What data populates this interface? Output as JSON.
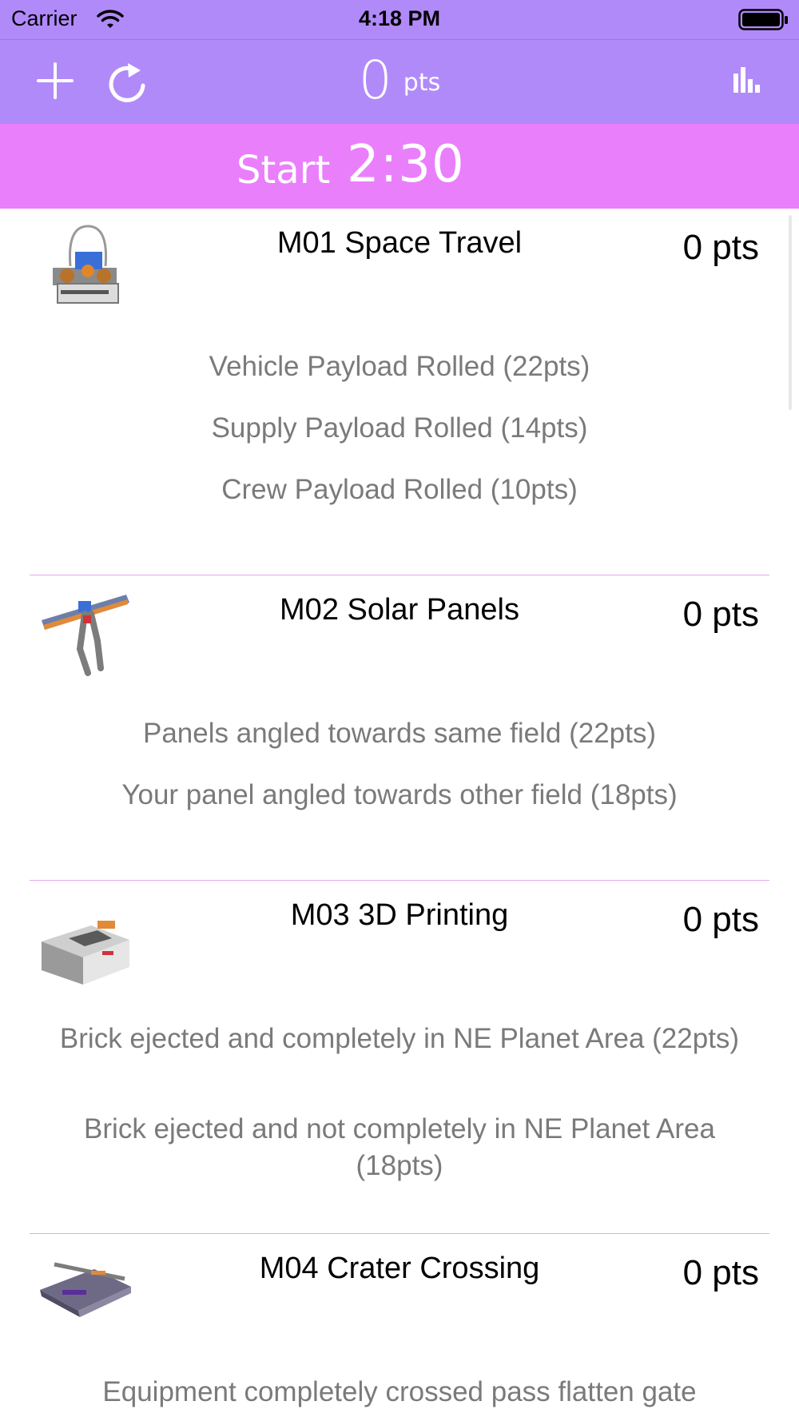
{
  "status_bar": {
    "carrier": "Carrier",
    "time": "4:18 PM"
  },
  "nav_bar": {
    "total_score": "0",
    "total_unit": "pts",
    "icons": [
      "add-icon",
      "refresh-icon",
      "bar-chart-icon"
    ]
  },
  "timer_bar": {
    "start_label": "Start",
    "time": "2:30"
  },
  "colors": {
    "nav_background": "#b18afa",
    "timer_background": "#ea7ffb",
    "divider": "#e7a8f0",
    "option_text": "#7a7a7a"
  },
  "missions": [
    {
      "title": "M01 Space Travel",
      "points": "0 pts",
      "options": [
        "Vehicle Payload Rolled  (22pts)",
        "Supply Payload Rolled  (14pts)",
        "Crew Payload Rolled  (10pts)"
      ]
    },
    {
      "title": "M02 Solar Panels",
      "points": "0 pts",
      "options": [
        "Panels angled towards same field (22pts)",
        "Your panel angled towards other field (18pts)"
      ]
    },
    {
      "title": "M03 3D Printing",
      "points": "0 pts",
      "options": [
        "Brick ejected and completely in NE Planet Area (22pts)",
        "Brick ejected and not completely in NE Planet Area (18pts)"
      ]
    },
    {
      "title": "M04 Crater Crossing",
      "points": "0 pts",
      "options": [
        "Equipment completely crossed pass flatten gate"
      ]
    }
  ]
}
